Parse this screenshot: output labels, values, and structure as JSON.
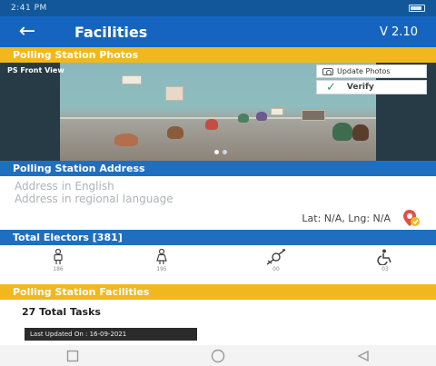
{
  "status_bar": {
    "time": "2:41 PM",
    "battery": ""
  },
  "app_bar": {
    "back_icon": "arrow-left-icon",
    "title": "Facilities",
    "version": "V 2.10"
  },
  "photos_section": {
    "title": "Polling Station Photos",
    "photo_caption": "PS Front View",
    "update_photos_label": "Update Photos",
    "verify_label": "Verify",
    "carousel_pages": 2,
    "carousel_active": 1
  },
  "address_section": {
    "title": "Polling Station Address",
    "address_english_placeholder": "Address in English",
    "address_regional_placeholder": "Address in regional language",
    "lat_lng": "Lat: N/A, Lng: N/A"
  },
  "electors_section": {
    "title": "Total Electors [381]",
    "categories": [
      {
        "icon": "male-icon",
        "count": "186"
      },
      {
        "icon": "female-icon",
        "count": "195"
      },
      {
        "icon": "third-gender-icon",
        "count": "00"
      },
      {
        "icon": "wheelchair-icon",
        "count": "03"
      }
    ]
  },
  "facilities_section": {
    "title": "Polling Station Facilities",
    "total_tasks": "27 Total Tasks",
    "last_updated": "Last Updated On : 16-09-2021"
  },
  "colors": {
    "primary": "#1565c0",
    "accent": "#f1b81e",
    "status_bar": "#12579a",
    "check": "#2e9e4f"
  }
}
